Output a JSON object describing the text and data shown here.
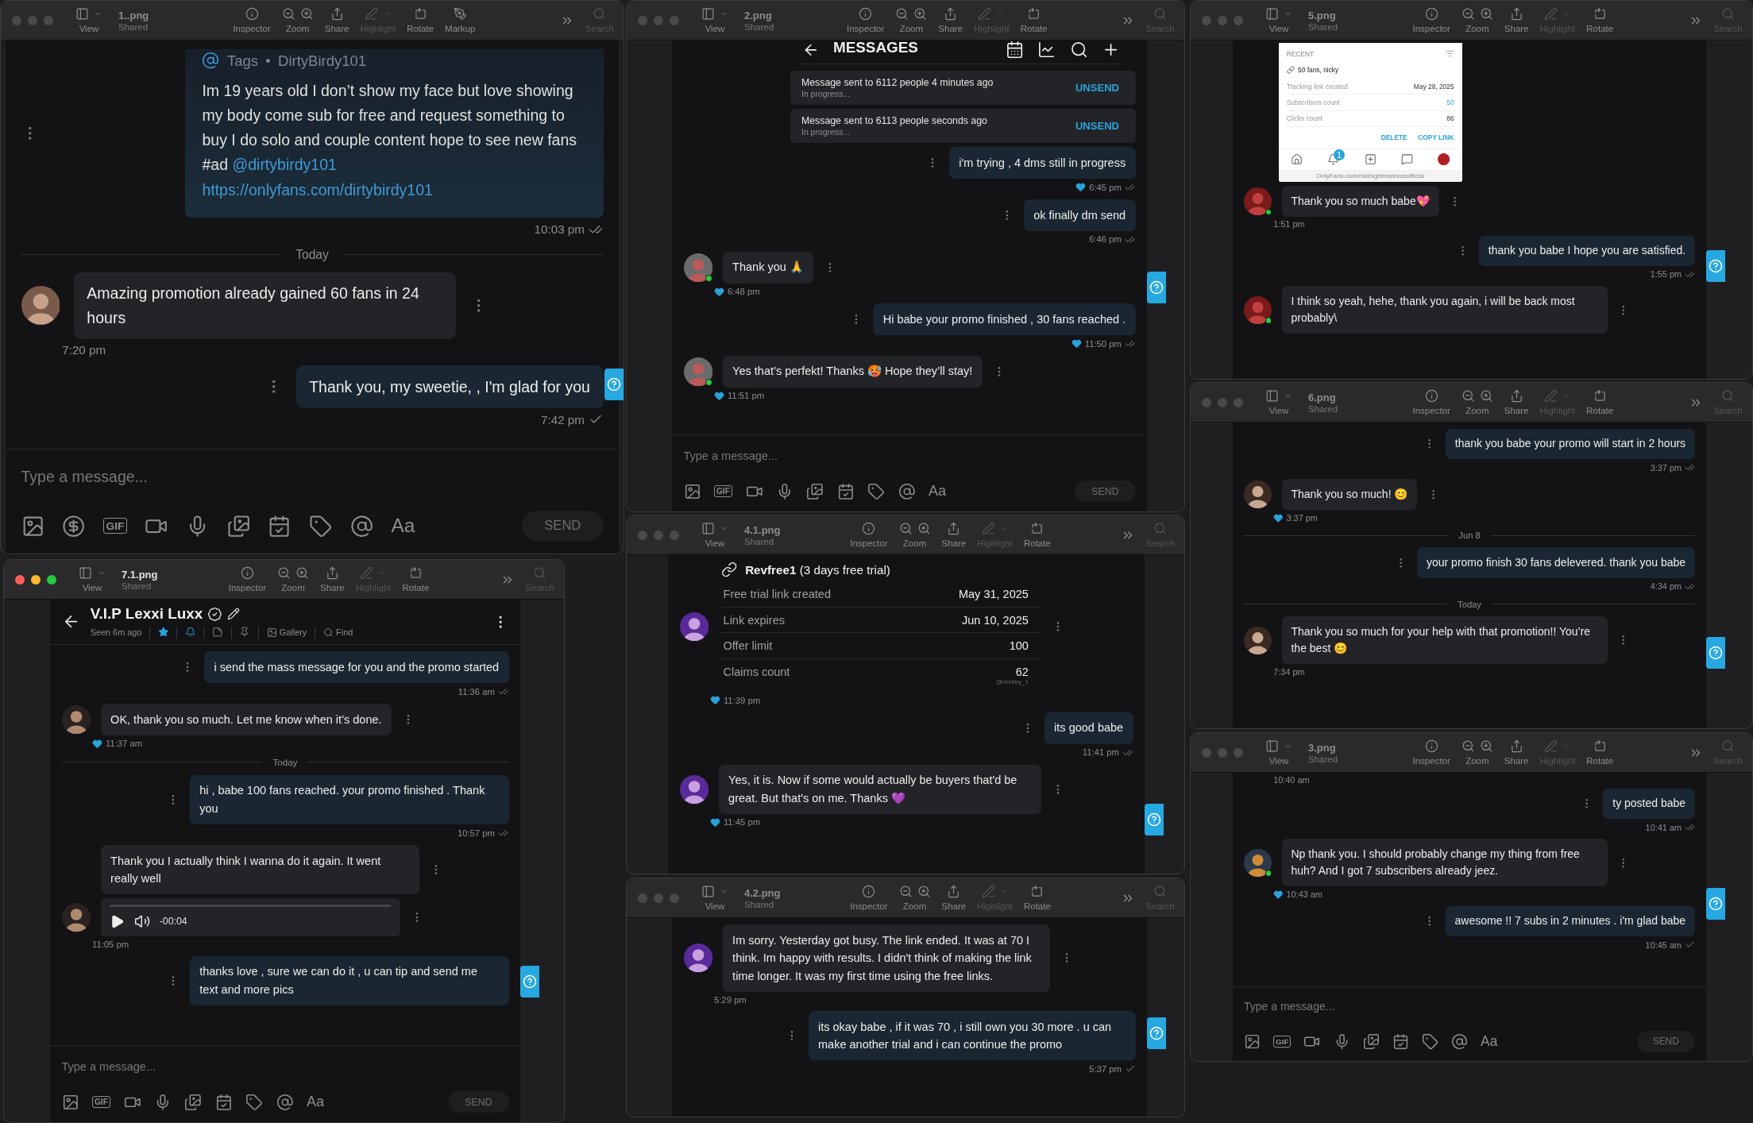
{
  "windows": [
    {
      "file": "1..png",
      "shared": "Shared",
      "focused": false,
      "help_tab": true,
      "toolbar": [
        {
          "kind": "view",
          "label": "View",
          "disabled": false
        },
        {
          "kind": "inspector",
          "label": "Inspector",
          "disabled": false
        },
        {
          "kind": "zoom",
          "label": "Zoom",
          "disabled": false
        },
        {
          "kind": "share",
          "label": "Share",
          "disabled": false
        },
        {
          "kind": "highlight",
          "label": "Highlight",
          "disabled": true
        },
        {
          "kind": "rotate",
          "label": "Rotate",
          "disabled": false
        },
        {
          "kind": "markup",
          "label": "Markup",
          "disabled": false
        },
        {
          "kind": "search",
          "label": "Search",
          "disabled": true
        }
      ],
      "messages": [
        {
          "kind": "tags_post",
          "tag_label": "Tags",
          "tag_separator": "•",
          "tag_user": "DirtyBirdy101",
          "text": "Im 19 years old I don’t show my face but love showing my body come sub for free and request something to buy I do solo and couple content hope to see new fans #ad",
          "mention": "@dirtybirdy101",
          "link": "https://onlyfans.com/dirtybirdy101",
          "time": "10:03 pm",
          "read": true
        },
        {
          "kind": "divider",
          "text": "Today"
        },
        {
          "kind": "in",
          "text": "Amazing promotion already gained 60 fans in 24 hours",
          "avatar": true,
          "online": false,
          "liked": false,
          "time": "7:20 pm"
        },
        {
          "kind": "out",
          "text": "Thank you, my sweetie, , I'm glad for you",
          "liked": false,
          "time": "7:42 pm",
          "read": false
        }
      ],
      "composer": {
        "placeholder": "Type a message...",
        "send": "SEND",
        "tools": [
          {
            "kind": "image"
          },
          {
            "kind": "tip"
          },
          {
            "kind": "gif",
            "label": "GIF"
          },
          {
            "kind": "video"
          },
          {
            "kind": "mic"
          },
          {
            "kind": "media"
          },
          {
            "kind": "calendar"
          },
          {
            "kind": "tag"
          },
          {
            "kind": "mention"
          },
          {
            "kind": "font",
            "label": "Aa"
          }
        ]
      }
    },
    {
      "file": "7.1.png",
      "shared": "Shared",
      "focused": true,
      "help_tab": true,
      "toolbar": [
        {
          "kind": "view",
          "label": "View",
          "disabled": false
        },
        {
          "kind": "inspector",
          "label": "Inspector",
          "disabled": false
        },
        {
          "kind": "zoom",
          "label": "Zoom",
          "disabled": false
        },
        {
          "kind": "share",
          "label": "Share",
          "disabled": false
        },
        {
          "kind": "highlight",
          "label": "Highlight",
          "disabled": true
        },
        {
          "kind": "rotate",
          "label": "Rotate",
          "disabled": false
        },
        {
          "kind": "search",
          "label": "Search",
          "disabled": true
        }
      ],
      "header": {
        "kind": "contact",
        "name": "V.I.P Lexxi Luxx",
        "status": "Seen 6m ago",
        "actions": [
          {
            "kind": "favorite"
          },
          {
            "kind": "notify"
          },
          {
            "kind": "note"
          },
          {
            "kind": "pin"
          },
          {
            "kind": "gallery",
            "label": "Gallery"
          },
          {
            "kind": "find",
            "label": "Find"
          }
        ]
      },
      "messages": [
        {
          "kind": "out",
          "text": "i send the mass message for you and the promo started",
          "liked": false,
          "time": "11:36 am",
          "read": true
        },
        {
          "kind": "in",
          "text": "OK, thank you so much. Let me know when it’s done.",
          "avatar": true,
          "online": false,
          "liked": true,
          "time": "11:37 am"
        },
        {
          "kind": "divider",
          "text": "Today"
        },
        {
          "kind": "out",
          "text": "hi , babe 100 fans reached. your promo finished . Thank you",
          "liked": false,
          "time": "10:57 pm",
          "read": true
        },
        {
          "kind": "in",
          "text": "Thank you I actually think I wanna do it again. It went really well",
          "avatar": false,
          "online": false,
          "liked": false
        },
        {
          "kind": "audio",
          "duration": "-00:04",
          "avatar": true,
          "online": false,
          "liked": false,
          "time": "11:05 pm"
        },
        {
          "kind": "out",
          "text": "thanks love , sure we can do it , u can tip and send me text and more pics",
          "liked": false
        }
      ],
      "composer": {
        "placeholder": "Type a message...",
        "send": "SEND",
        "tools": [
          {
            "kind": "image"
          },
          {
            "kind": "gif",
            "label": "GIF"
          },
          {
            "kind": "video"
          },
          {
            "kind": "mic"
          },
          {
            "kind": "media"
          },
          {
            "kind": "calendar"
          },
          {
            "kind": "tag"
          },
          {
            "kind": "mention"
          },
          {
            "kind": "font",
            "label": "Aa"
          }
        ]
      }
    },
    {
      "file": "2.png",
      "shared": "Shared",
      "focused": false,
      "help_tab": true,
      "toolbar": [
        {
          "kind": "view",
          "label": "View",
          "disabled": false
        },
        {
          "kind": "inspector",
          "label": "Inspector",
          "disabled": false
        },
        {
          "kind": "zoom",
          "label": "Zoom",
          "disabled": false
        },
        {
          "kind": "share",
          "label": "Share",
          "disabled": false
        },
        {
          "kind": "highlight",
          "label": "Highlight",
          "disabled": true
        },
        {
          "kind": "rotate",
          "label": "Rotate",
          "disabled": false
        },
        {
          "kind": "search",
          "label": "Search",
          "disabled": true
        }
      ],
      "header": {
        "kind": "title",
        "title": "MESSAGES",
        "actions": [
          {
            "kind": "calendar"
          },
          {
            "kind": "stats"
          },
          {
            "kind": "search"
          },
          {
            "kind": "new"
          }
        ]
      },
      "messages": [
        {
          "kind": "status",
          "text": "Message sent to 6112 people 4 minutes ago",
          "sub": "In progress...",
          "action": "UNSEND"
        },
        {
          "kind": "status",
          "text": "Message sent to 6113 people seconds ago",
          "sub": "In progress...",
          "action": "UNSEND"
        },
        {
          "kind": "out",
          "text": "i'm trying , 4 dms still in progress",
          "liked": true,
          "time": "6:45 pm",
          "read": true
        },
        {
          "kind": "out",
          "text": "ok finally dm send",
          "liked": false,
          "time": "6:46 pm",
          "read": true
        },
        {
          "kind": "in",
          "text": "Thank you 🙏",
          "avatar": true,
          "online": true,
          "liked": true,
          "time": "6:48 pm"
        },
        {
          "kind": "out",
          "text": "Hi babe your promo finished , 30 fans reached .",
          "liked": true,
          "time": "11:50 pm",
          "read": true
        },
        {
          "kind": "in",
          "text": "Yes that’s perfekt! Thanks 🥵 Hope they’ll stay!",
          "avatar": true,
          "online": true,
          "liked": true,
          "time": "11:51 pm"
        }
      ],
      "composer": {
        "placeholder": "Type a message...",
        "send": "SEND",
        "tools": [
          {
            "kind": "image"
          },
          {
            "kind": "gif",
            "label": "GIF"
          },
          {
            "kind": "video"
          },
          {
            "kind": "mic"
          },
          {
            "kind": "media"
          },
          {
            "kind": "calendar"
          },
          {
            "kind": "tag"
          },
          {
            "kind": "mention"
          },
          {
            "kind": "font",
            "label": "Aa"
          }
        ]
      }
    },
    {
      "file": "4.1.png",
      "shared": "Shared",
      "focused": false,
      "help_tab": true,
      "toolbar": [
        {
          "kind": "view",
          "label": "View",
          "disabled": false
        },
        {
          "kind": "inspector",
          "label": "Inspector",
          "disabled": false
        },
        {
          "kind": "zoom",
          "label": "Zoom",
          "disabled": false
        },
        {
          "kind": "share",
          "label": "Share",
          "disabled": false
        },
        {
          "kind": "highlight",
          "label": "Highlight",
          "disabled": true
        },
        {
          "kind": "rotate",
          "label": "Rotate",
          "disabled": false
        },
        {
          "kind": "search",
          "label": "Search",
          "disabled": true
        }
      ],
      "messages": [
        {
          "kind": "trial",
          "title": "**Revfree1** (3 days free trial)",
          "rows": [
            {
              "label": "Free trial link created",
              "value": "May 31, 2025"
            },
            {
              "label": "Link expires",
              "value": "Jun 10, 2025"
            },
            {
              "label": "Offer limit",
              "value": "100"
            },
            {
              "label": "Claims count",
              "value": "62",
              "sub": "@revelry_1"
            }
          ],
          "avatar": true,
          "online": false,
          "liked": true,
          "time": "11:39 pm"
        },
        {
          "kind": "out",
          "text": "its good babe",
          "liked": false,
          "time": "11:41 pm",
          "read": true
        },
        {
          "kind": "in",
          "text": "Yes, it is. Now if some would actually be buyers that'd be great. But that's on me. Thanks 💜",
          "avatar": true,
          "online": false,
          "liked": true,
          "time": "11:45 pm"
        }
      ]
    },
    {
      "file": "4.2.png",
      "shared": "Shared",
      "focused": false,
      "help_tab": true,
      "toolbar": [
        {
          "kind": "view",
          "label": "View",
          "disabled": false
        },
        {
          "kind": "inspector",
          "label": "Inspector",
          "disabled": false
        },
        {
          "kind": "zoom",
          "label": "Zoom",
          "disabled": false
        },
        {
          "kind": "share",
          "label": "Share",
          "disabled": false
        },
        {
          "kind": "highlight",
          "label": "Highlight",
          "disabled": true
        },
        {
          "kind": "rotate",
          "label": "Rotate",
          "disabled": false
        },
        {
          "kind": "search",
          "label": "Search",
          "disabled": true
        }
      ],
      "messages": [
        {
          "kind": "in",
          "text": "Im sorry. Yesterday got busy. The link ended. It was at 70 I think. Im happy with results. I didn't think of making the link time longer. It was my first time using the free links.",
          "avatar": true,
          "online": false,
          "liked": false,
          "time": "5:29 pm"
        },
        {
          "kind": "out",
          "text": "its okay babe , if it was 70 , i still own you 30 more . u can make another trial and i can continue the promo",
          "liked": false,
          "time": "5:37 pm",
          "read": false
        }
      ]
    },
    {
      "file": "5.png",
      "shared": "Shared",
      "focused": false,
      "help_tab": true,
      "toolbar": [
        {
          "kind": "view",
          "label": "View",
          "disabled": false
        },
        {
          "kind": "inspector",
          "label": "Inspector",
          "disabled": false
        },
        {
          "kind": "zoom",
          "label": "Zoom",
          "disabled": false
        },
        {
          "kind": "share",
          "label": "Share",
          "disabled": false
        },
        {
          "kind": "highlight",
          "label": "Highlight",
          "disabled": true
        },
        {
          "kind": "rotate",
          "label": "Rotate",
          "disabled": false
        },
        {
          "kind": "search",
          "label": "Search",
          "disabled": true
        }
      ],
      "messages": [
        {
          "kind": "screenshot",
          "heading": "RECENT",
          "link_title": "50 fans, nicky",
          "rows": [
            {
              "label": "Tracking link created",
              "value": "May 28, 2025",
              "highlighted": false
            },
            {
              "label": "Subscribers count",
              "value": "50",
              "highlighted": true
            },
            {
              "label": "Clicks count",
              "value": "86",
              "highlighted": false
            }
          ],
          "actions": [
            "DELETE",
            "COPY LINK"
          ],
          "badge": "1",
          "url": "OnlyFans.com/midnightmistressofficial"
        },
        {
          "kind": "in",
          "text": "Thank you so much babe💖",
          "avatar": true,
          "online": true,
          "liked": false,
          "time": "1:51 pm"
        },
        {
          "kind": "out",
          "text": "thank you babe I hope you are satisfied.",
          "liked": false,
          "time": "1:55 pm",
          "read": true
        },
        {
          "kind": "in",
          "text": "I think so yeah, hehe, thank you again, i will be back most probably\\",
          "avatar": true,
          "online": true,
          "liked": false
        }
      ]
    },
    {
      "file": "6.png",
      "shared": "Shared",
      "focused": false,
      "help_tab": true,
      "toolbar": [
        {
          "kind": "view",
          "label": "View",
          "disabled": false
        },
        {
          "kind": "inspector",
          "label": "Inspector",
          "disabled": false
        },
        {
          "kind": "zoom",
          "label": "Zoom",
          "disabled": false
        },
        {
          "kind": "share",
          "label": "Share",
          "disabled": false
        },
        {
          "kind": "highlight",
          "label": "Highlight",
          "disabled": true
        },
        {
          "kind": "rotate",
          "label": "Rotate",
          "disabled": false
        },
        {
          "kind": "search",
          "label": "Search",
          "disabled": true
        }
      ],
      "messages": [
        {
          "kind": "out",
          "text": "thank you babe your promo will start in 2 hours",
          "liked": false,
          "time": "3:37 pm",
          "read": true
        },
        {
          "kind": "in",
          "text": "Thank you so much! 😊",
          "avatar": true,
          "online": false,
          "liked": true,
          "time": "3:37 pm"
        },
        {
          "kind": "divider",
          "text": "Jun 8"
        },
        {
          "kind": "out",
          "text": "your promo finish 30 fans delevered. thank you babe",
          "liked": false,
          "time": "4:34 pm",
          "read": true
        },
        {
          "kind": "divider",
          "text": "Today"
        },
        {
          "kind": "in",
          "text": "Thank you so much for your help with that promotion!! You’re the best 😊",
          "avatar": true,
          "online": false,
          "liked": false,
          "time": "7:34 pm"
        }
      ]
    },
    {
      "file": "3.png",
      "shared": "Shared",
      "focused": false,
      "help_tab": true,
      "toolbar": [
        {
          "kind": "view",
          "label": "View",
          "disabled": false
        },
        {
          "kind": "inspector",
          "label": "Inspector",
          "disabled": false
        },
        {
          "kind": "zoom",
          "label": "Zoom",
          "disabled": false
        },
        {
          "kind": "share",
          "label": "Share",
          "disabled": false
        },
        {
          "kind": "highlight",
          "label": "Highlight",
          "disabled": true
        },
        {
          "kind": "rotate",
          "label": "Rotate",
          "disabled": false
        },
        {
          "kind": "search",
          "label": "Search",
          "disabled": true
        }
      ],
      "messages": [
        {
          "kind": "stamp",
          "time": "10:40 am"
        },
        {
          "kind": "out",
          "text": "ty posted babe",
          "liked": false,
          "time": "10:41 am",
          "read": true
        },
        {
          "kind": "in",
          "text": "Np thank you. I should probably change my thing from free huh? And I got 7 subscribers already jeez.",
          "avatar": true,
          "online": true,
          "liked": true,
          "time": "10:43 am"
        },
        {
          "kind": "out",
          "text": "awesome !! 7 subs in 2 minutes . i'm glad babe",
          "liked": false,
          "time": "10:45 am",
          "read": false
        }
      ],
      "composer": {
        "placeholder": "Type a message...",
        "send": "SEND",
        "tools": [
          {
            "kind": "image"
          },
          {
            "kind": "gif",
            "label": "GIF"
          },
          {
            "kind": "video"
          },
          {
            "kind": "mic"
          },
          {
            "kind": "media"
          },
          {
            "kind": "calendar"
          },
          {
            "kind": "tag"
          },
          {
            "kind": "mention"
          },
          {
            "kind": "font",
            "label": "Aa"
          }
        ]
      }
    }
  ]
}
